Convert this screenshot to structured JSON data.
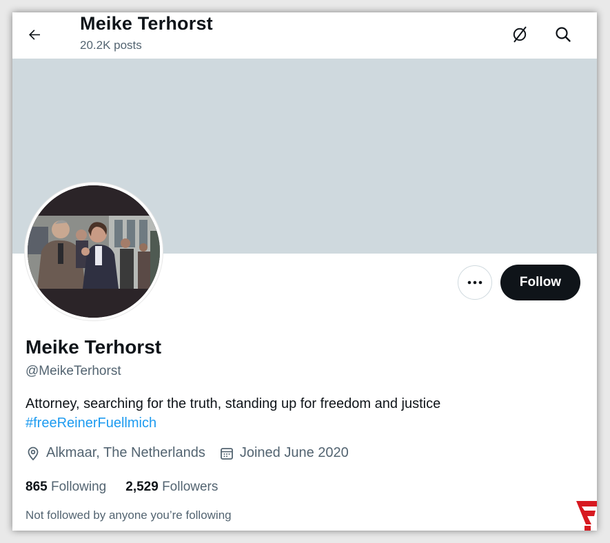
{
  "header": {
    "title": "Meike Terhorst",
    "posts_count": "20.2K posts",
    "back_icon": "arrow-left-icon",
    "grok_icon": "grok-slash-circle-icon",
    "search_icon": "search-icon"
  },
  "profile": {
    "name": "Meike Terhorst",
    "handle": "@MeikeTerhorst",
    "bio": "Attorney,  searching for the truth, standing up for freedom and justice",
    "bio_hashtag": "#freeReinerFuellmich",
    "location": "Alkmaar, The Netherlands",
    "joined": "Joined June 2020",
    "following_count": "865",
    "following_label": "Following",
    "followers_count": "2,529",
    "followers_label": "Followers",
    "not_followed_text": "Not followed by anyone you’re following"
  },
  "actions": {
    "more_label": "···",
    "follow_label": "Follow"
  },
  "colors": {
    "banner": "#cfd9de",
    "link": "#1d9bf0",
    "follow_bg": "#0f1419",
    "muted_text": "#536471",
    "brand_red": "#d71920"
  }
}
